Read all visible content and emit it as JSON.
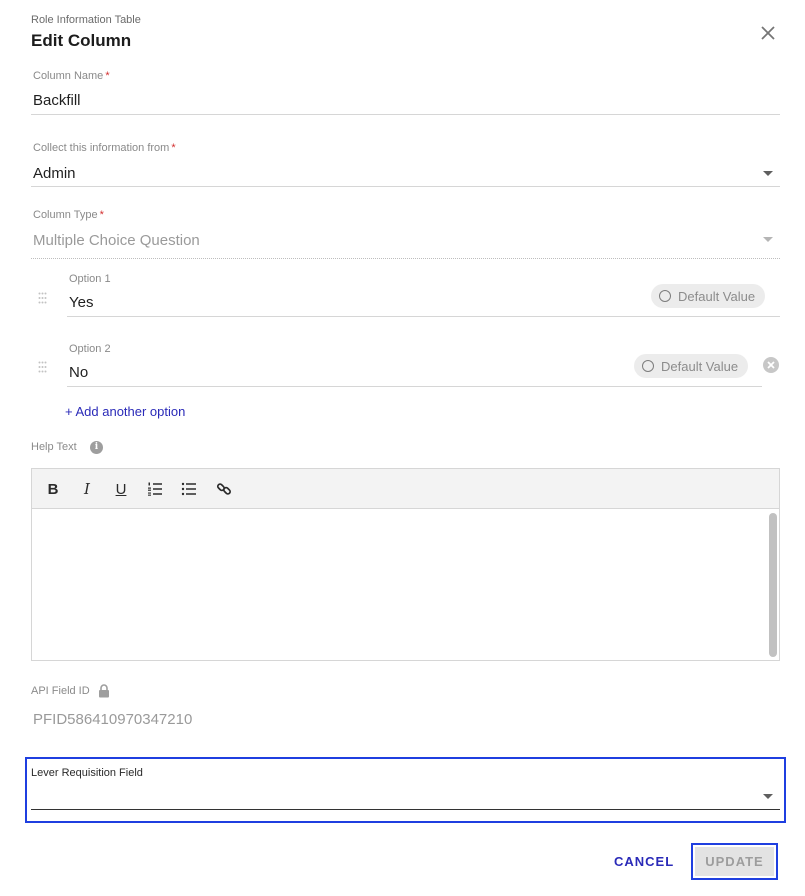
{
  "dialog": {
    "subtitle": "Role Information Table",
    "title": "Edit Column"
  },
  "fields": {
    "column_name": {
      "label": "Column Name",
      "required_mark": "*",
      "value": "Backfill"
    },
    "collect_from": {
      "label": "Collect this information from",
      "required_mark": "*",
      "value": "Admin"
    },
    "column_type": {
      "label": "Column Type",
      "required_mark": "*",
      "value": "Multiple Choice Question"
    }
  },
  "options": [
    {
      "label": "Option 1",
      "value": "Yes",
      "default_label": "Default Value"
    },
    {
      "label": "Option 2",
      "value": "No",
      "default_label": "Default Value"
    }
  ],
  "add_option": "+ Add another option",
  "help_text": {
    "label": "Help Text",
    "info_glyph": "i",
    "toolbar": {
      "bold": "B",
      "italic": "I",
      "underline": "U"
    }
  },
  "api_field": {
    "label": "API Field ID",
    "value": "PFID586410970347210"
  },
  "lever": {
    "label": "Lever Requisition Field",
    "value": ""
  },
  "actions": {
    "cancel": "CANCEL",
    "update": "UPDATE"
  },
  "icons": {
    "close": "close-icon",
    "dropdown": "chevron-down-icon",
    "drag": "drag-handle-icon",
    "radio": "radio-icon",
    "remove": "remove-circle-icon",
    "info": "info-icon",
    "lock": "lock-icon",
    "ordered_list": "ordered-list-icon",
    "bullet_list": "bullet-list-icon",
    "link": "link-icon"
  },
  "colors": {
    "accent": "#2a2ab8",
    "required": "#d32f2f",
    "highlight": "#1f3fe0"
  }
}
